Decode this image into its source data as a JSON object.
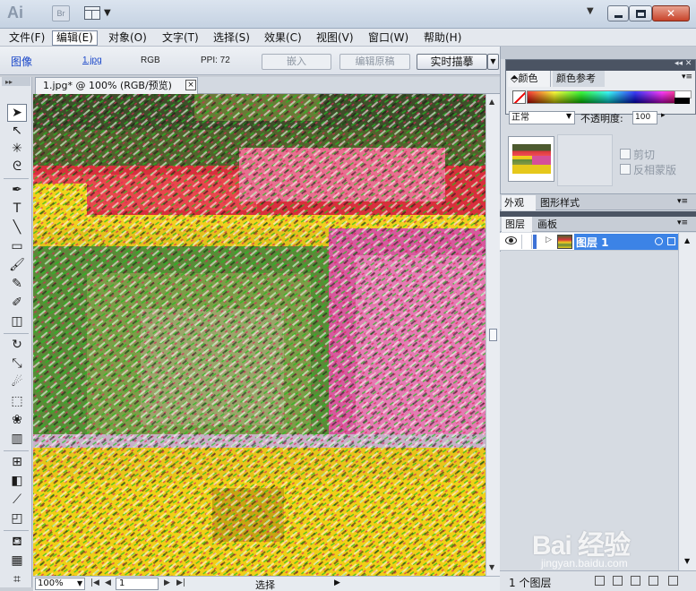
{
  "titlebar": {
    "app_logo": "Ai",
    "bridge_badge": "Br",
    "arrange_icon": "arrange-documents-icon",
    "collapse_glyph": "▼"
  },
  "menu": [
    "文件(F)",
    "编辑(E)",
    "对象(O)",
    "文字(T)",
    "选择(S)",
    "效果(C)",
    "视图(V)",
    "窗口(W)",
    "帮助(H)"
  ],
  "menu_active_index": 1,
  "control_bar": {
    "object_type": "图像",
    "filename": "1.jpg",
    "color_mode": "RGB",
    "ppi": "PPI: 72",
    "embed_button": "嵌入",
    "edit_original_button": "编辑原稿",
    "live_trace_button": "实时描摹"
  },
  "document_tab": {
    "title": "1.jpg* @ 100% (RGB/预览)",
    "close": "×"
  },
  "tools": [
    "selection-tool",
    "direct-selection-tool",
    "magic-wand-tool",
    "lasso-tool",
    "pen-tool",
    "type-tool",
    "line-tool",
    "rectangle-tool",
    "paintbrush-tool",
    "pencil-tool",
    "blob-brush-tool",
    "eraser-tool",
    "rotate-tool",
    "scale-tool",
    "warp-tool",
    "free-transform-tool",
    "symbol-sprayer-tool",
    "column-graph-tool",
    "mesh-tool",
    "gradient-tool",
    "eyedropper-tool",
    "blend-tool",
    "live-paint-tool",
    "artboard-tool",
    "slice-tool"
  ],
  "status_bar": {
    "zoom": "100%",
    "page": "1",
    "mode": "选择"
  },
  "color_panel": {
    "tab_color": "颜色",
    "tab_color_guide": "颜色参考"
  },
  "transparency": {
    "blend_mode": "正常",
    "opacity_label": "不透明度:",
    "opacity_value": "100",
    "clip_label": "剪切",
    "invert_mask_label": "反相蒙版"
  },
  "appearance_panel": {
    "tab_appearance": "外观",
    "tab_graphic_styles": "图形样式"
  },
  "layers_panel": {
    "tab_layers": "图层",
    "tab_artboards": "画板",
    "layer_name": "图层 1",
    "layer_count": "1 个图层"
  },
  "watermark": {
    "mark": "Bai 经验",
    "url": "jingyan.baidu.com"
  },
  "colors": {
    "accent": "#3c83e6",
    "close_red": "#c8432a",
    "link_blue": "#1a47c9"
  }
}
